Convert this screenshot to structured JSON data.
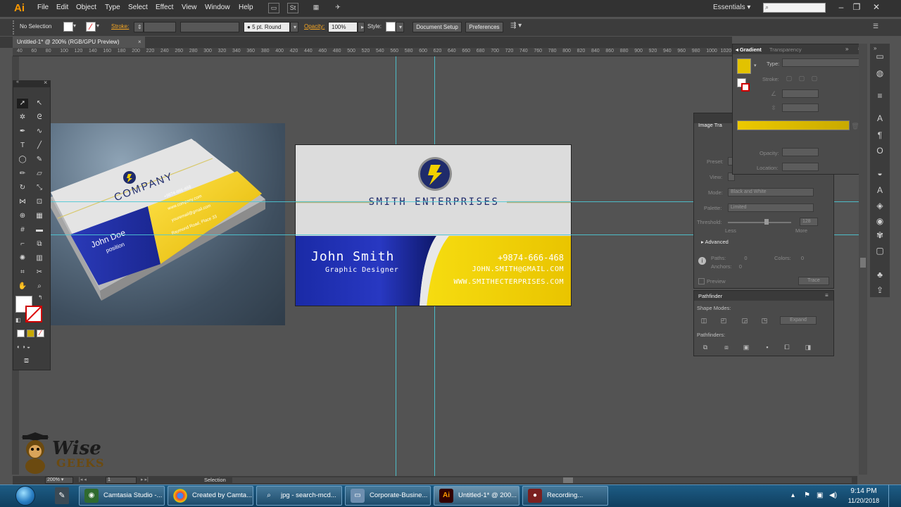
{
  "app": {
    "logo": "Ai",
    "menu": [
      "File",
      "Edit",
      "Object",
      "Type",
      "Select",
      "Effect",
      "View",
      "Window",
      "Help"
    ],
    "workspace": "Essentials",
    "search_placeholder": ""
  },
  "control_bar": {
    "selection_label": "No Selection",
    "stroke_label": "Stroke:",
    "brush_value": "5 pt. Round",
    "opacity_label": "Opacity:",
    "opacity_value": "100%",
    "style_label": "Style:",
    "document_setup": "Document Setup",
    "preferences": "Preferences"
  },
  "document": {
    "tab_title": "Untitled-1* @ 200% (RGB/GPU Preview)",
    "ruler_ticks": [
      "40",
      "60",
      "80",
      "100",
      "120",
      "140",
      "160",
      "180",
      "200",
      "220",
      "240",
      "260",
      "280",
      "300",
      "320",
      "340",
      "360",
      "380",
      "400",
      "420",
      "440",
      "460",
      "480",
      "500",
      "520",
      "540",
      "560",
      "580",
      "600",
      "620",
      "640",
      "660",
      "680",
      "700",
      "720",
      "740",
      "760",
      "780",
      "800",
      "820",
      "840",
      "860",
      "880",
      "900",
      "920",
      "940",
      "960",
      "980",
      "1000",
      "1020"
    ]
  },
  "card": {
    "company": "SMITH ENTERPRISES",
    "name": "John Smith",
    "role": "Graphic Designer",
    "phone": "+9874-666-468",
    "email": "JOHN.SMITH@GMAIL.COM",
    "website": "WWW.SMITHECTERPRISES.COM",
    "colors": {
      "blue": "#1f2fa8",
      "blue_dark": "#0f1a6e",
      "yellow": "#f3d000",
      "yellow_light": "#ffe34a",
      "grey": "#dcdcdc",
      "logo_ring": "#1f2b6b",
      "stripe": "#b8b07a"
    }
  },
  "mockup": {
    "company": "COMPANY",
    "name": "John Doe",
    "position": "position",
    "phone": "+9874-666-468",
    "email": "www.company.com",
    "site": "youremail@gmail.com",
    "address": "Raymond Road, Place 33"
  },
  "gradient_panel": {
    "tab_gradient": "Gradient",
    "tab_transparency": "Transparency",
    "type_label": "Type:",
    "stroke_label": "Stroke:",
    "opacity_label": "Opacity:",
    "location_label": "Location:",
    "gradient_start": "#e8c800",
    "gradient_end": "#c9aa00"
  },
  "image_trace_panel": {
    "title": "Image Tra",
    "preset_label": "Preset:",
    "view_label": "View:",
    "mode_label": "Mode:",
    "mode_value": "Black and White",
    "palette_label": "Palette:",
    "palette_value": "Limited",
    "threshold_label": "Threshold:",
    "threshold_value": "128",
    "less_label": "Less",
    "more_label": "More",
    "advanced_label": "Advanced",
    "paths_label": "Paths:",
    "paths_value": "0",
    "colors_label": "Colors:",
    "colors_value": "0",
    "anchors_label": "Anchors:",
    "anchors_value": "0",
    "preview_label": "Preview",
    "trace_button": "Trace"
  },
  "pathfinder_panel": {
    "title": "Pathfinder",
    "shape_modes": "Shape Modes:",
    "pathfinders": "Pathfinders:",
    "expand": "Expand"
  },
  "status_bar": {
    "zoom": "200%",
    "page": "1",
    "tool": "Selection"
  },
  "watermark": {
    "line1": "Wise",
    "line2": "GEEKS"
  },
  "taskbar": {
    "tasks": [
      "Camtasia Studio -...",
      "Created by Camta...",
      "jpg - search-mcd...",
      "Corporate-Busine...",
      "Untitled-1* @ 200...",
      "Recording..."
    ],
    "time": "9:14 PM",
    "date": "11/20/2018"
  }
}
